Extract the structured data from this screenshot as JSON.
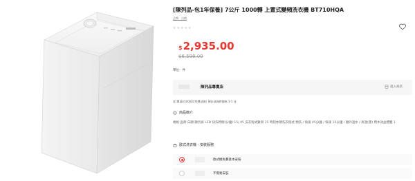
{
  "product": {
    "title": "[陳列品-包1年保養] 7公斤 1000轉 上置式變頻洗衣機 BT710HQA",
    "brand_link": "品牌：白朗",
    "price_currency": "$",
    "price": "2,935.00",
    "old_price": "$6,598.00",
    "unit": "單位：件"
  },
  "store": {
    "name": "陳列品專賣店",
    "enter_label": "進入商店"
  },
  "shipping_note": "(訂單滿$500即可免費送貨) 預計送貨時間為 3-5 日",
  "intro": {
    "title": "商品簡介",
    "text": "規格 品牌 白朗 顯示屏 LED 快洗時間(分鐘) 15/ 45 洗衣程式數目 15 時刻亦節洗衣程式 預洗 / 快速 45分鐘 / 快速 15分鐘 / 額外過水 / 高溫(需) 用水效益標籤 1"
  },
  "service": {
    "title": "歐式洗衣機 - 安裝服務",
    "options": [
      {
        "label": "歐式機免費基本安裝",
        "selected": true
      },
      {
        "label": "不需要安裝",
        "selected": false
      }
    ]
  },
  "icons": {
    "favorite": "heart-icon",
    "store": "store-icon",
    "intro": "info-icon",
    "service": "bag-icon"
  },
  "colors": {
    "price": "#e8362f",
    "selected": "#e8362f"
  }
}
